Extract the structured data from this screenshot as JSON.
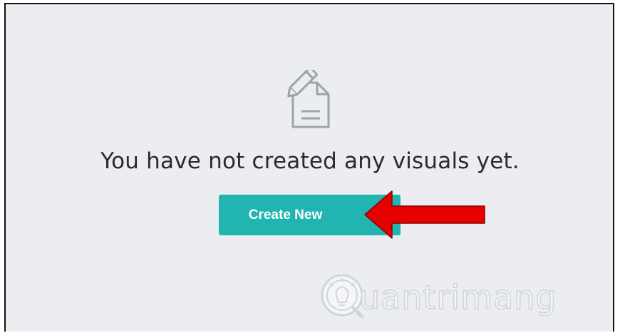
{
  "empty_state": {
    "icon": "document-edit-icon",
    "message": "You have not created any visuals yet.",
    "create_button_label": "Create New"
  },
  "annotation": {
    "arrow_color": "#e60000",
    "points_to": "create-new-button"
  },
  "watermark": {
    "text": "uantrimang",
    "logo_icon": "lightbulb-q-logo"
  },
  "colors": {
    "background": "#ebedf0",
    "button": "#22b4b0",
    "text": "#2b2b2b",
    "arrow": "#e60000"
  }
}
